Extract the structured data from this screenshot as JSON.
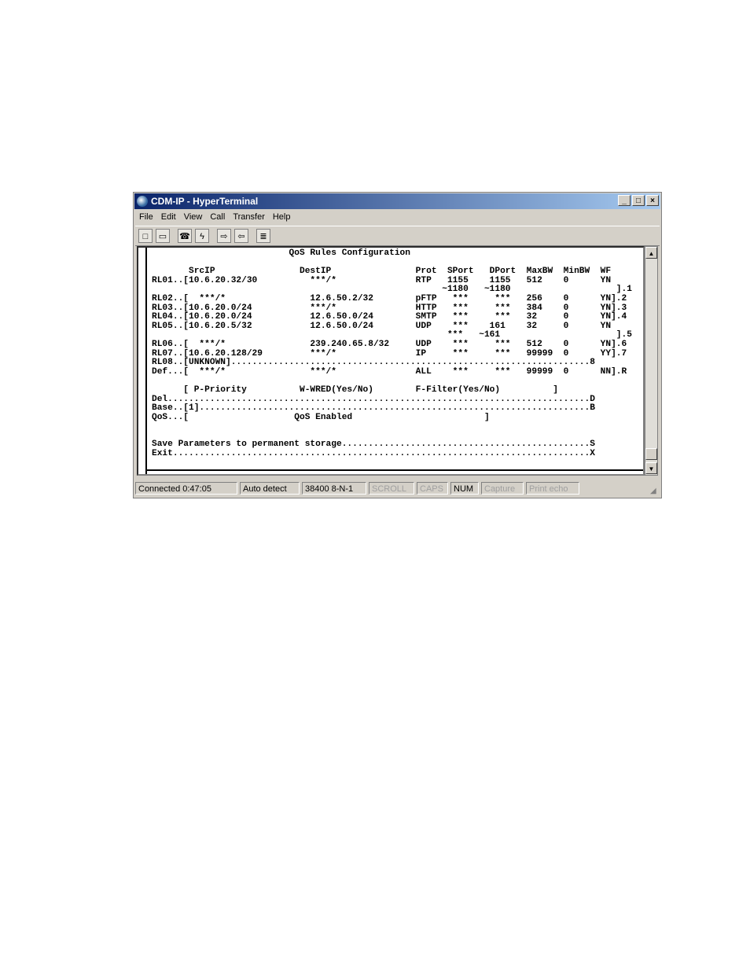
{
  "window": {
    "title": "CDM-IP - HyperTerminal",
    "controls": {
      "minimize": "_",
      "maximize": "□",
      "close": "×"
    }
  },
  "menu": [
    "File",
    "Edit",
    "View",
    "Call",
    "Transfer",
    "Help"
  ],
  "toolbar": {
    "icons": [
      "new-icon",
      "open-icon",
      "connect-icon",
      "disconnect-icon",
      "send-icon",
      "receive-icon",
      "properties-icon"
    ]
  },
  "terminal": {
    "lines": [
      "                          QoS Rules Configuration",
      "",
      "       SrcIP                DestIP                Prot  SPort   DPort  MaxBW  MinBW  WF",
      "RL01..[10.6.20.32/30          ***/*               RTP   1155    1155   512    0      YN",
      "                                                       ~1180   ~1180                    ].1",
      "RL02..[  ***/*                12.6.50.2/32        pFTP   ***     ***   256    0      YN].2",
      "RL03..[10.6.20.0/24           ***/*               HTTP   ***     ***   384    0      YN].3",
      "RL04..[10.6.20.0/24           12.6.50.0/24        SMTP   ***     ***   32     0      YN].4",
      "RL05..[10.6.20.5/32           12.6.50.0/24        UDP    ***    161    32     0      YN",
      "                                                        ***   ~161                      ].5",
      "RL06..[  ***/*                239.240.65.8/32     UDP    ***     ***   512    0      YN].6",
      "RL07..[10.6.20.128/29         ***/*               IP     ***     ***   99999  0      YY].7",
      "RL08..[UNKNOWN]....................................................................8",
      "Def...[  ***/*                ***/*               ALL    ***     ***   99999  0      NN].R",
      "",
      "      [ P-Priority          W-WRED(Yes/No)        F-Filter(Yes/No)          ]",
      "Del................................................................................D",
      "Base..[1]..........................................................................B",
      "QoS...[                    QoS Enabled                         ]",
      "",
      "",
      "Save Parameters to permanent storage...............................................S",
      "Exit...............................................................................X"
    ]
  },
  "status": {
    "connected": "Connected 0:47:05",
    "detect": "Auto detect",
    "port": "38400 8-N-1",
    "scroll": "SCROLL",
    "caps": "CAPS",
    "num": "NUM",
    "capture": "Capture",
    "print_echo": "Print echo"
  }
}
